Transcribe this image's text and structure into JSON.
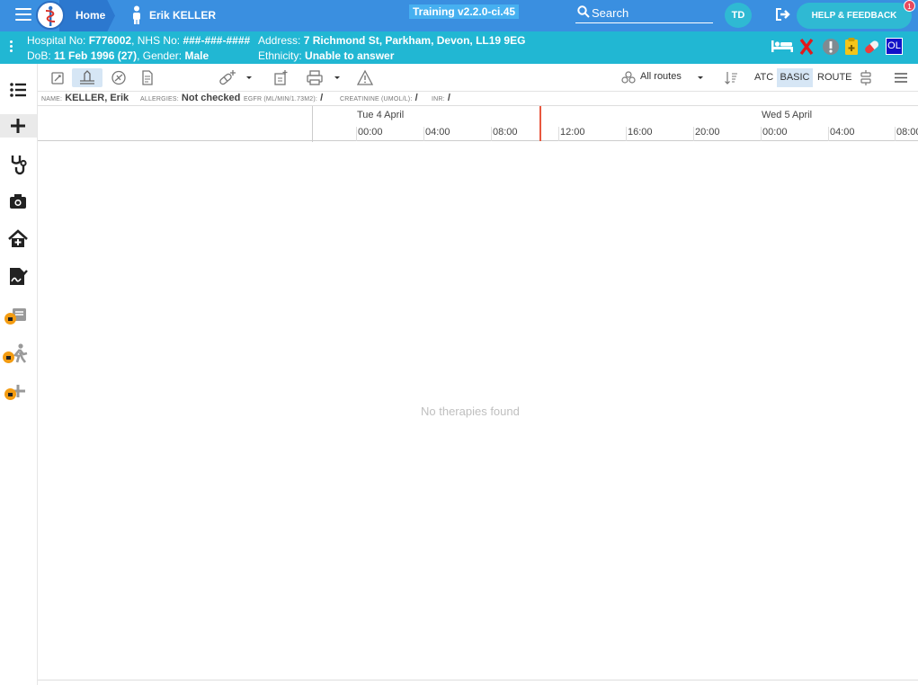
{
  "topbar": {
    "home_label": "Home",
    "patient_name": "Erik KELLER",
    "training_label": "Training v2.2.0-ci.45",
    "search_label": "Search",
    "avatar_initials": "TD",
    "help_label": "HELP & FEEDBACK",
    "help_badge": "1",
    "accent": "#3a8fe0"
  },
  "banner": {
    "hospital_label": "Hospital No: ",
    "hospital_no": "F776002",
    "nhs_label": ", NHS No: ",
    "nhs_no": "###-###-####",
    "address_label": "Address: ",
    "address": "7 Richmond St, Parkham, Devon, LL19 9EG",
    "dob_label": "DoB: ",
    "dob": "11 Feb 1996 (27)",
    "gender_label": ", Gender: ",
    "gender": "Male",
    "ethnicity_label": "Ethnicity: ",
    "ethnicity": "Unable to answer",
    "ol_badge": "OL",
    "color": "#21b7d3"
  },
  "toolbar": {
    "routes_label": "All routes",
    "atc_label": "ATC",
    "basic_label": "BASIC",
    "route_label": "ROUTE"
  },
  "info": {
    "name_label": "NAME:",
    "name_value": "KELLER, Erik",
    "allergies_label": "ALLERGIES:",
    "allergies_value": "Not checked",
    "egfr_label": "EGFR (ML/MIN/1.73M2):",
    "egfr_value": "/",
    "creatinine_label": "CREATININE (UMOL/L):",
    "creatinine_value": "/",
    "inr_label": "INR:",
    "inr_value": "/"
  },
  "timeline": {
    "day1": "Tue 4 April",
    "day2": "Wed 5 April",
    "hours": [
      "00:00",
      "04:00",
      "08:00",
      "12:00",
      "16:00",
      "20:00",
      "00:00",
      "04:00",
      "08:00"
    ]
  },
  "empty_message": "No therapies found"
}
